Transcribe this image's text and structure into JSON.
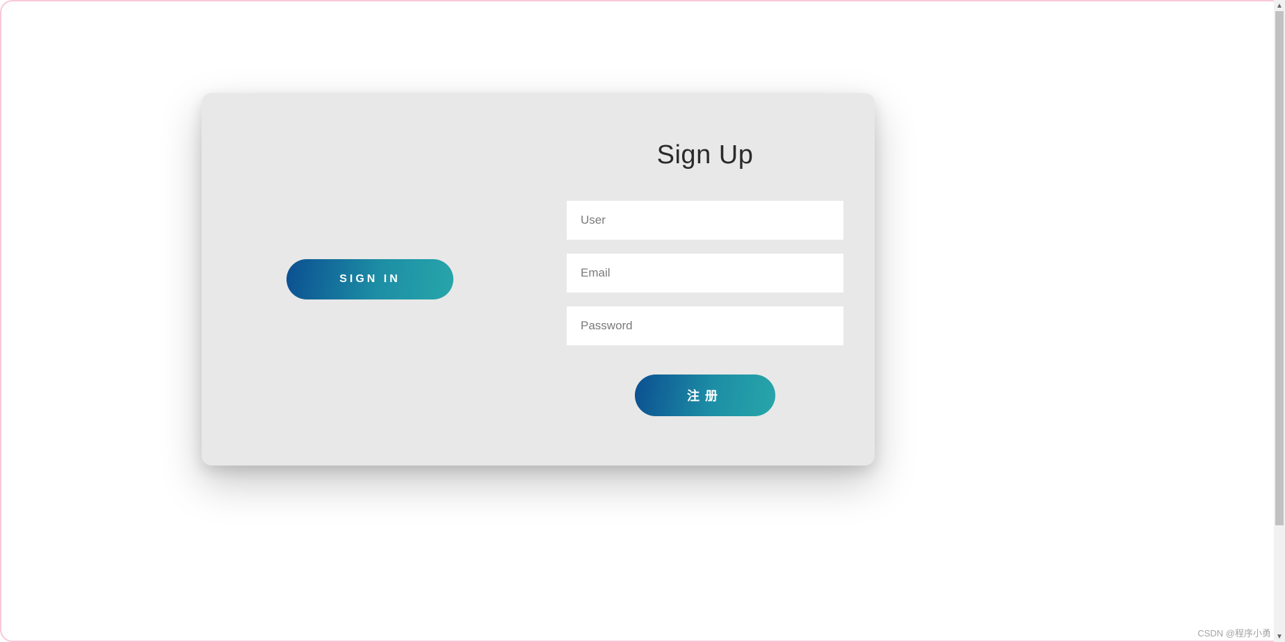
{
  "form": {
    "heading": "Sign Up",
    "user_placeholder": "User",
    "email_placeholder": "Email",
    "password_placeholder": "Password",
    "signin_label": "SIGN IN",
    "register_label": "注册"
  },
  "watermark": "CSDN @程序小勇"
}
